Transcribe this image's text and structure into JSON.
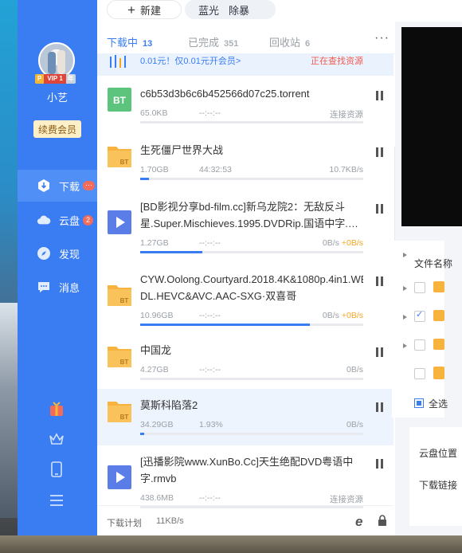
{
  "toolbar": {
    "new_label": "新建",
    "light_options": [
      "蓝光",
      "除暴"
    ]
  },
  "sidebar": {
    "username": "小艺",
    "vip": {
      "p": "P",
      "level": "VIP 1",
      "year": "年"
    },
    "renew_label": "续费会员",
    "nav": [
      {
        "label": "下载",
        "badge": "···",
        "icon": "download-icon"
      },
      {
        "label": "云盘",
        "badge": "2",
        "icon": "cloud-icon"
      },
      {
        "label": "发现",
        "icon": "compass-icon"
      },
      {
        "label": "消息",
        "icon": "message-icon"
      }
    ],
    "bottom_icons": [
      "gift-icon",
      "crown-icon",
      "phone-icon",
      "menu-icon"
    ]
  },
  "tabs": [
    {
      "label": "下载中",
      "count": "13"
    },
    {
      "label": "已完成",
      "count": "351"
    },
    {
      "label": "回收站",
      "count": "6"
    }
  ],
  "more_label": "···",
  "promo": {
    "text": "0.01元！仅0.01元开会员>",
    "warn": "正在查找资源"
  },
  "tasks": [
    {
      "name": "c6b53d3b6c6b452566d07c25.torrent",
      "size": "65.0KB",
      "remaining": "--:--:--",
      "status": "连接资源",
      "accel": "",
      "progress": 0,
      "type": "bt-green"
    },
    {
      "name": "生死僵尸世界大战",
      "size": "1.70GB",
      "remaining": "44:32:53",
      "status": "10.7KB/s",
      "accel": "",
      "progress": 0.04,
      "type": "bt-folder"
    },
    {
      "name": "[BD影视分享bd-film.cc]新乌龙院2：无敌反斗星.Super.Mischieves.1995.DVDRip.国语中字.…",
      "size": "1.27GB",
      "remaining": "--:--:--",
      "status": "0B/s ",
      "accel": "+0B/s",
      "progress": 0.28,
      "type": "video"
    },
    {
      "name": "CYW.Oolong.Courtyard.2018.4K&1080p.4in1.WEB-DL.HEVC&AVC.AAC-SXG·双喜哥",
      "size": "10.96GB",
      "remaining": "--:--:--",
      "status": "0B/s ",
      "accel": "+0B/s",
      "progress": 0.76,
      "type": "bt-folder"
    },
    {
      "name": "中国龙",
      "size": "4.27GB",
      "remaining": "--:--:--",
      "status": "0B/s",
      "accel": "",
      "progress": 0,
      "type": "bt-folder"
    },
    {
      "name": "莫斯科陷落2",
      "size": "34.29GB",
      "remaining": "1.93%",
      "status": "0B/s",
      "accel": "",
      "progress": 0.0193,
      "type": "bt-folder"
    },
    {
      "name": "[迅播影院www.XunBo.Cc]天生绝配DVD粤语中字.rmvb",
      "size": "438.6MB",
      "remaining": "--:--:--",
      "status": "连接资源",
      "accel": "",
      "progress": 0,
      "type": "video"
    }
  ],
  "footer": {
    "plan_label": "下载计划",
    "speed": "11KB/s"
  },
  "detail": {
    "file_header": "文件名称",
    "select_all": "全选",
    "cloud_location": "云盘位置",
    "download_link": "下载链接"
  },
  "colors": {
    "accent": "#3a7df2",
    "sidebar": "#3a7df2",
    "folder": "#f7b33d",
    "bt_green": "#5cc47c",
    "video": "#5b7de8",
    "warn": "#f25a4d",
    "accel": "#f5a623"
  }
}
